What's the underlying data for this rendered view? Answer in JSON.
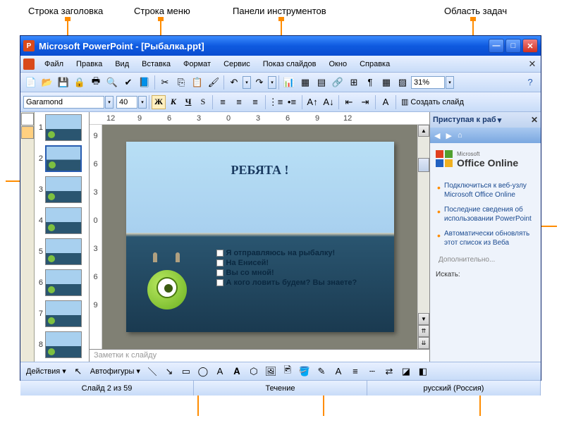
{
  "callouts": {
    "titlebar": "Строка заголовка",
    "menubar": "Строка меню",
    "toolbars": "Панели инструментов",
    "taskpane": "Область задач"
  },
  "titlebar": {
    "app_icon": "P",
    "title": "Microsoft PowerPoint - [Рыбалка.ppt]"
  },
  "menu": {
    "file": "Файл",
    "edit": "Правка",
    "view": "Вид",
    "insert": "Вставка",
    "format": "Формат",
    "tools": "Сервис",
    "slideshow": "Показ слайдов",
    "window": "Окно",
    "help": "Справка"
  },
  "std_toolbar": {
    "zoom": "31%"
  },
  "fmt_toolbar": {
    "font": "Garamond",
    "size": "40",
    "bold": "Ж",
    "italic": "К",
    "underline": "Ч",
    "shadow": "S",
    "new_slide": "Создать слайд"
  },
  "hruler": [
    "12",
    "9",
    "6",
    "3",
    "0",
    "3",
    "6",
    "9",
    "12"
  ],
  "vruler": [
    "9",
    "6",
    "3",
    "0",
    "3",
    "6",
    "9"
  ],
  "thumbs": [
    "1",
    "2",
    "3",
    "4",
    "5",
    "6",
    "7",
    "8"
  ],
  "slide": {
    "title": "РЕБЯТА !",
    "bullets": [
      "Я отправляюсь на рыбалку!",
      "На Енисей!",
      "Вы со мной!",
      "А кого ловить будем? Вы знаете?"
    ]
  },
  "notes": {
    "placeholder": "Заметки к слайду"
  },
  "taskpane": {
    "title": "Приступая к раб",
    "office_online": "Office Online",
    "office_prefix": "Microsoft",
    "links": [
      "Подключиться к веб-узлу Microsoft Office Online",
      "Последние сведения об использовании PowerPoint",
      "Автоматически обновлять этот список из Веба"
    ],
    "more": "Дополнительно...",
    "search_label": "Искать:"
  },
  "draw_toolbar": {
    "actions": "Действия",
    "autoshapes": "Автофигуры"
  },
  "status": {
    "slide": "Слайд 2 из 59",
    "design": "Течение",
    "lang": "русский (Россия)"
  }
}
